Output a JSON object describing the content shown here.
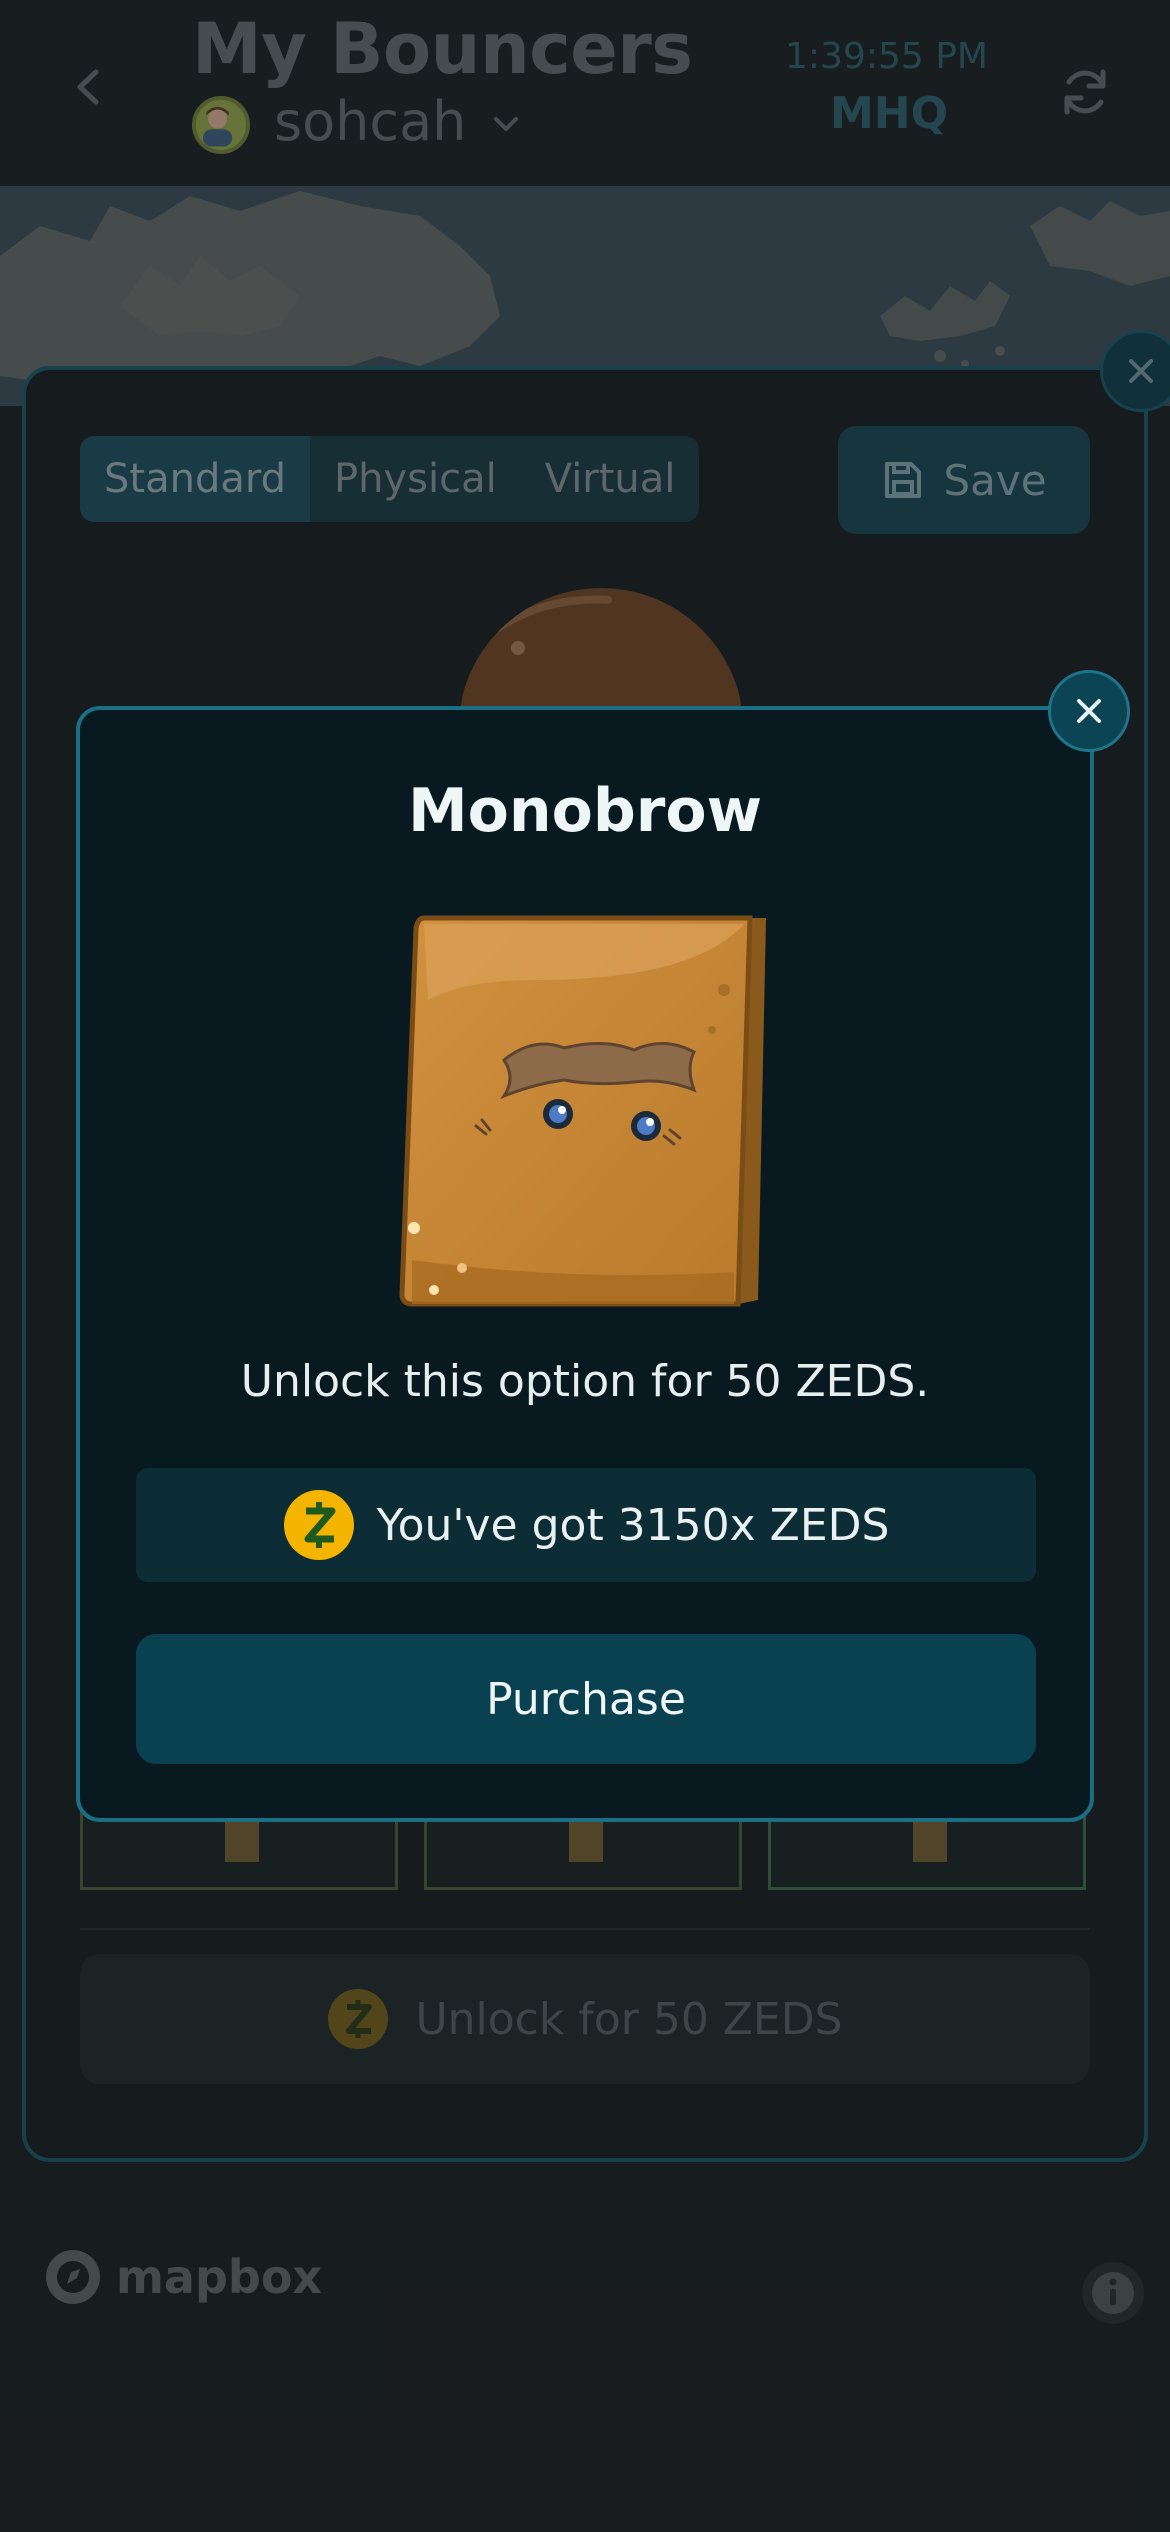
{
  "header": {
    "title": "My Bouncers",
    "user_name": "sohcah",
    "clock": "1:39:55 PM",
    "hq_label": "MHQ"
  },
  "editor": {
    "tabs": [
      {
        "label": "Standard",
        "active": true
      },
      {
        "label": "Physical",
        "active": false
      },
      {
        "label": "Virtual",
        "active": false
      }
    ],
    "save_label": "Save",
    "unlock_label": "Unlock for 50 ZEDS"
  },
  "map": {
    "attribution_label": "mapbox"
  },
  "modal": {
    "title": "Monobrow",
    "unlock_text": "Unlock this option for 50 ZEDS.",
    "balance_text": "You've got 3150x ZEDS",
    "purchase_label": "Purchase"
  },
  "icons": {
    "back": "chevron-left-icon",
    "refresh": "refresh-icon",
    "close": "close-icon",
    "save": "floppy-disk-icon",
    "zeds": "zeds-coin-icon",
    "info": "info-icon"
  },
  "colors": {
    "accent": "#1a6f85",
    "modal_bg": "#081a20",
    "purchase_bg": "#0a4150",
    "coin": "#f4b400",
    "coin_mark": "#1e5a1e"
  }
}
